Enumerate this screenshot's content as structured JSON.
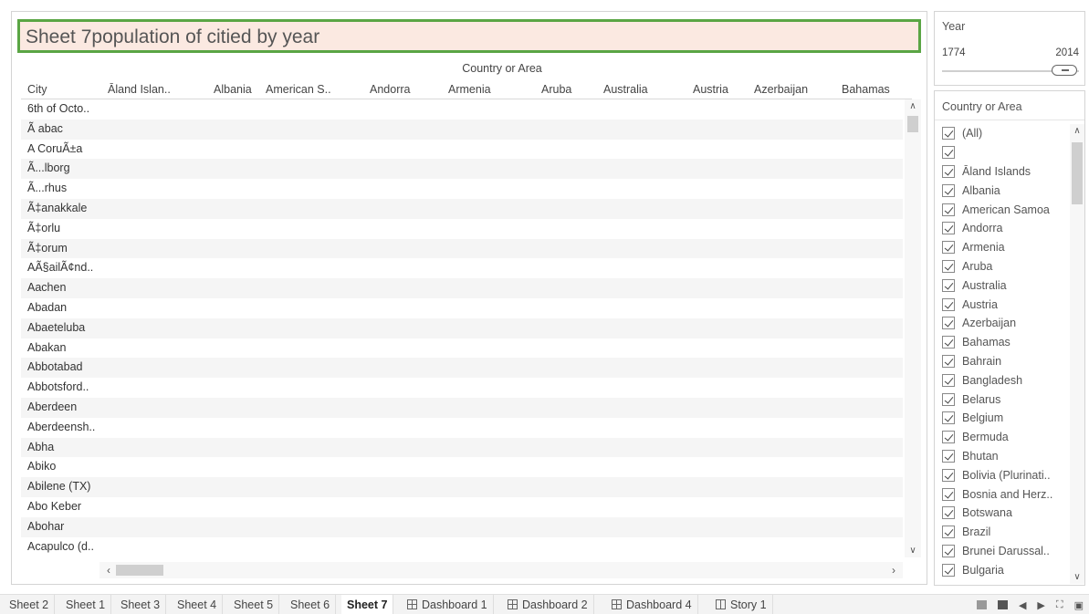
{
  "sheet": {
    "title": "Sheet 7population of citied by year",
    "column_group_header": "Country or Area",
    "row_header": "City",
    "columns": [
      "Āland Islan..",
      "Albania",
      "American S..",
      "Andorra",
      "Armenia",
      "Aruba",
      "Australia",
      "Austria",
      "Azerbaijan",
      "Bahamas"
    ],
    "rows": [
      "6th of Octo..",
      "Ã abac",
      "A CoruÃ±a",
      "Ã...lborg",
      "Ã...rhus",
      "Ã‡anakkale",
      "Ã‡orlu",
      "Ã‡orum",
      "AÃ§ailÃ¢nd..",
      "Aachen",
      "Abadan",
      "Abaeteluba",
      "Abakan",
      "Abbotabad",
      "Abbotsford..",
      "Aberdeen",
      "Aberdeensh..",
      "Abha",
      "Abiko",
      "Abilene (TX)",
      "Abo Keber",
      "Abohar",
      "Acapulco (d.."
    ]
  },
  "year_filter": {
    "title": "Year",
    "min": "1774",
    "max": "2014",
    "value_fraction": 1.0
  },
  "country_filter": {
    "title": "Country or Area",
    "items": [
      "(All)",
      "",
      "Āland Islands",
      "Albania",
      "American Samoa",
      "Andorra",
      "Armenia",
      "Aruba",
      "Australia",
      "Austria",
      "Azerbaijan",
      "Bahamas",
      "Bahrain",
      "Bangladesh",
      "Belarus",
      "Belgium",
      "Bermuda",
      "Bhutan",
      "Bolivia (Plurinati..",
      "Bosnia and Herz..",
      "Botswana",
      "Brazil",
      "Brunei Darussal..",
      "Bulgaria"
    ]
  },
  "tabs": {
    "sheet2": "Sheet 2",
    "sheet1": "Sheet 1",
    "sheet3": "Sheet 3",
    "sheet4": "Sheet 4",
    "sheet5": "Sheet 5",
    "sheet6": "Sheet 6",
    "sheet7": "Sheet 7",
    "dashboard1": "Dashboard 1",
    "dashboard2": "Dashboard 2",
    "dashboard4": "Dashboard 4",
    "story1": "Story 1"
  },
  "colors": {
    "title_border": "#5aa544",
    "title_fill": "#fbe9e1"
  }
}
